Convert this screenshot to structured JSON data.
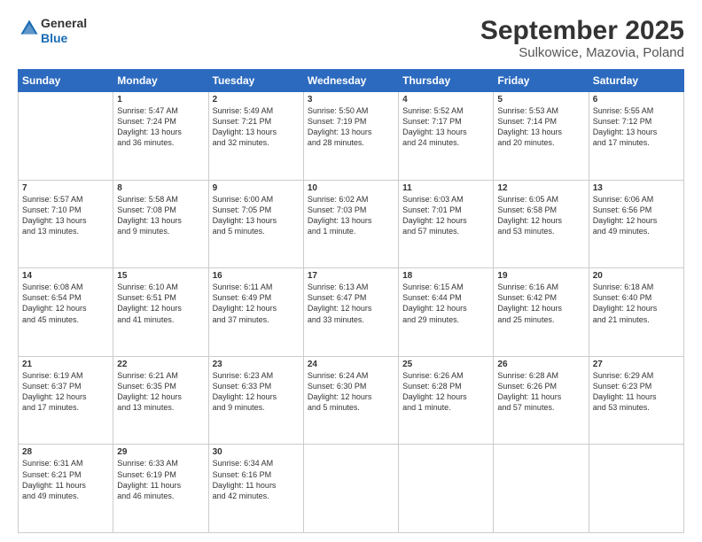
{
  "header": {
    "logo_line1": "General",
    "logo_line2": "Blue",
    "title": "September 2025",
    "subtitle": "Sulkowice, Mazovia, Poland"
  },
  "weekdays": [
    "Sunday",
    "Monday",
    "Tuesday",
    "Wednesday",
    "Thursday",
    "Friday",
    "Saturday"
  ],
  "weeks": [
    [
      {
        "day": "",
        "info": ""
      },
      {
        "day": "1",
        "info": "Sunrise: 5:47 AM\nSunset: 7:24 PM\nDaylight: 13 hours\nand 36 minutes."
      },
      {
        "day": "2",
        "info": "Sunrise: 5:49 AM\nSunset: 7:21 PM\nDaylight: 13 hours\nand 32 minutes."
      },
      {
        "day": "3",
        "info": "Sunrise: 5:50 AM\nSunset: 7:19 PM\nDaylight: 13 hours\nand 28 minutes."
      },
      {
        "day": "4",
        "info": "Sunrise: 5:52 AM\nSunset: 7:17 PM\nDaylight: 13 hours\nand 24 minutes."
      },
      {
        "day": "5",
        "info": "Sunrise: 5:53 AM\nSunset: 7:14 PM\nDaylight: 13 hours\nand 20 minutes."
      },
      {
        "day": "6",
        "info": "Sunrise: 5:55 AM\nSunset: 7:12 PM\nDaylight: 13 hours\nand 17 minutes."
      }
    ],
    [
      {
        "day": "7",
        "info": "Sunrise: 5:57 AM\nSunset: 7:10 PM\nDaylight: 13 hours\nand 13 minutes."
      },
      {
        "day": "8",
        "info": "Sunrise: 5:58 AM\nSunset: 7:08 PM\nDaylight: 13 hours\nand 9 minutes."
      },
      {
        "day": "9",
        "info": "Sunrise: 6:00 AM\nSunset: 7:05 PM\nDaylight: 13 hours\nand 5 minutes."
      },
      {
        "day": "10",
        "info": "Sunrise: 6:02 AM\nSunset: 7:03 PM\nDaylight: 13 hours\nand 1 minute."
      },
      {
        "day": "11",
        "info": "Sunrise: 6:03 AM\nSunset: 7:01 PM\nDaylight: 12 hours\nand 57 minutes."
      },
      {
        "day": "12",
        "info": "Sunrise: 6:05 AM\nSunset: 6:58 PM\nDaylight: 12 hours\nand 53 minutes."
      },
      {
        "day": "13",
        "info": "Sunrise: 6:06 AM\nSunset: 6:56 PM\nDaylight: 12 hours\nand 49 minutes."
      }
    ],
    [
      {
        "day": "14",
        "info": "Sunrise: 6:08 AM\nSunset: 6:54 PM\nDaylight: 12 hours\nand 45 minutes."
      },
      {
        "day": "15",
        "info": "Sunrise: 6:10 AM\nSunset: 6:51 PM\nDaylight: 12 hours\nand 41 minutes."
      },
      {
        "day": "16",
        "info": "Sunrise: 6:11 AM\nSunset: 6:49 PM\nDaylight: 12 hours\nand 37 minutes."
      },
      {
        "day": "17",
        "info": "Sunrise: 6:13 AM\nSunset: 6:47 PM\nDaylight: 12 hours\nand 33 minutes."
      },
      {
        "day": "18",
        "info": "Sunrise: 6:15 AM\nSunset: 6:44 PM\nDaylight: 12 hours\nand 29 minutes."
      },
      {
        "day": "19",
        "info": "Sunrise: 6:16 AM\nSunset: 6:42 PM\nDaylight: 12 hours\nand 25 minutes."
      },
      {
        "day": "20",
        "info": "Sunrise: 6:18 AM\nSunset: 6:40 PM\nDaylight: 12 hours\nand 21 minutes."
      }
    ],
    [
      {
        "day": "21",
        "info": "Sunrise: 6:19 AM\nSunset: 6:37 PM\nDaylight: 12 hours\nand 17 minutes."
      },
      {
        "day": "22",
        "info": "Sunrise: 6:21 AM\nSunset: 6:35 PM\nDaylight: 12 hours\nand 13 minutes."
      },
      {
        "day": "23",
        "info": "Sunrise: 6:23 AM\nSunset: 6:33 PM\nDaylight: 12 hours\nand 9 minutes."
      },
      {
        "day": "24",
        "info": "Sunrise: 6:24 AM\nSunset: 6:30 PM\nDaylight: 12 hours\nand 5 minutes."
      },
      {
        "day": "25",
        "info": "Sunrise: 6:26 AM\nSunset: 6:28 PM\nDaylight: 12 hours\nand 1 minute."
      },
      {
        "day": "26",
        "info": "Sunrise: 6:28 AM\nSunset: 6:26 PM\nDaylight: 11 hours\nand 57 minutes."
      },
      {
        "day": "27",
        "info": "Sunrise: 6:29 AM\nSunset: 6:23 PM\nDaylight: 11 hours\nand 53 minutes."
      }
    ],
    [
      {
        "day": "28",
        "info": "Sunrise: 6:31 AM\nSunset: 6:21 PM\nDaylight: 11 hours\nand 49 minutes."
      },
      {
        "day": "29",
        "info": "Sunrise: 6:33 AM\nSunset: 6:19 PM\nDaylight: 11 hours\nand 46 minutes."
      },
      {
        "day": "30",
        "info": "Sunrise: 6:34 AM\nSunset: 6:16 PM\nDaylight: 11 hours\nand 42 minutes."
      },
      {
        "day": "",
        "info": ""
      },
      {
        "day": "",
        "info": ""
      },
      {
        "day": "",
        "info": ""
      },
      {
        "day": "",
        "info": ""
      }
    ]
  ]
}
